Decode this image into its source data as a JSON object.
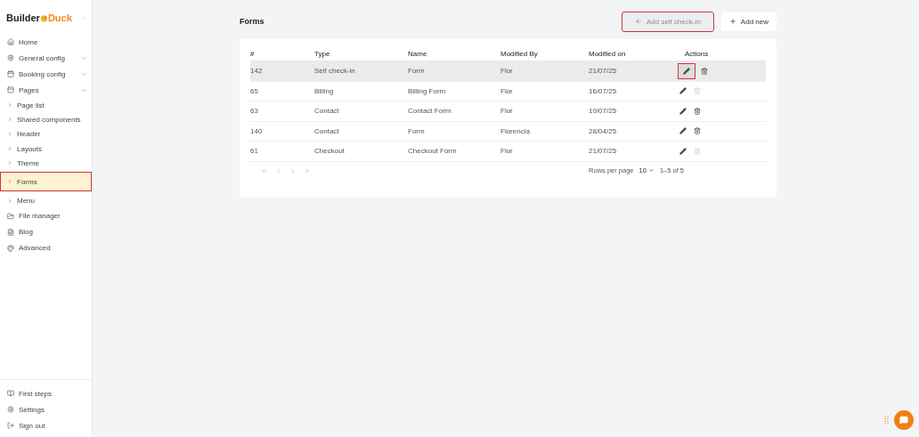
{
  "sidebar": {
    "logo": {
      "first": "Builder",
      "second": "Duck"
    },
    "items": [
      {
        "kind": "nav",
        "label": "Home",
        "selected": false,
        "annotated": false
      },
      {
        "kind": "group",
        "label": "General config",
        "expanded": false,
        "selected": false,
        "annotated": false
      },
      {
        "kind": "group",
        "label": "Booking config",
        "expanded": false,
        "selected": false,
        "annotated": false
      },
      {
        "kind": "group",
        "label": "Pages",
        "expanded": true,
        "selected": false,
        "annotated": false
      },
      {
        "kind": "sub",
        "label": "Page list",
        "selected": false,
        "annotated": false
      },
      {
        "kind": "sub",
        "label": "Shared components",
        "selected": false,
        "annotated": false
      },
      {
        "kind": "sub",
        "label": "Header",
        "selected": false,
        "annotated": false
      },
      {
        "kind": "sub",
        "label": "Layouts",
        "selected": false,
        "annotated": false
      },
      {
        "kind": "sub",
        "label": "Theme",
        "selected": false,
        "annotated": false
      },
      {
        "kind": "sub",
        "label": "Forms",
        "selected": true,
        "annotated": true
      },
      {
        "kind": "sub",
        "label": "Menu",
        "selected": false,
        "annotated": false
      },
      {
        "kind": "nav",
        "label": "File manager",
        "selected": false,
        "annotated": false
      },
      {
        "kind": "nav",
        "label": "Blog",
        "selected": false,
        "annotated": false
      },
      {
        "kind": "nav",
        "label": "Advanced",
        "selected": false,
        "annotated": false
      }
    ],
    "footer": [
      {
        "label": "First steps"
      },
      {
        "label": "Settings"
      },
      {
        "label": "Sign out"
      }
    ]
  },
  "page": {
    "title": "Forms",
    "buttons": [
      {
        "label": "Add self check-in",
        "disabled": true,
        "annotated": true
      },
      {
        "label": "Add new",
        "disabled": false,
        "annotated": false
      }
    ]
  },
  "table": {
    "columns": [
      "#",
      "Type",
      "Name",
      "Modified By",
      "Modified on",
      "Actions"
    ],
    "rows": [
      {
        "cells": [
          "142",
          "Self check-in",
          "Form",
          "Flor",
          "21/07/25"
        ],
        "hovered": true,
        "edit_annotated": true,
        "delete_disabled": false
      },
      {
        "cells": [
          "65",
          "Billing",
          "Billing Form",
          "Flor",
          "16/07/25"
        ],
        "hovered": false,
        "edit_annotated": false,
        "delete_disabled": true
      },
      {
        "cells": [
          "63",
          "Contact",
          "Contact Form",
          "Flor",
          "10/07/25"
        ],
        "hovered": false,
        "edit_annotated": false,
        "delete_disabled": false
      },
      {
        "cells": [
          "140",
          "Contact",
          "Form",
          "Florencia",
          "28/04/25"
        ],
        "hovered": false,
        "edit_annotated": false,
        "delete_disabled": false
      },
      {
        "cells": [
          "61",
          "Checkout",
          "Checkout Form",
          "Flor",
          "21/07/25"
        ],
        "hovered": false,
        "edit_annotated": false,
        "delete_disabled": true
      }
    ],
    "pagination": {
      "rows_per_page_label": "Rows per page",
      "rows_per_page": "10",
      "range": "1–5 of 5"
    }
  }
}
